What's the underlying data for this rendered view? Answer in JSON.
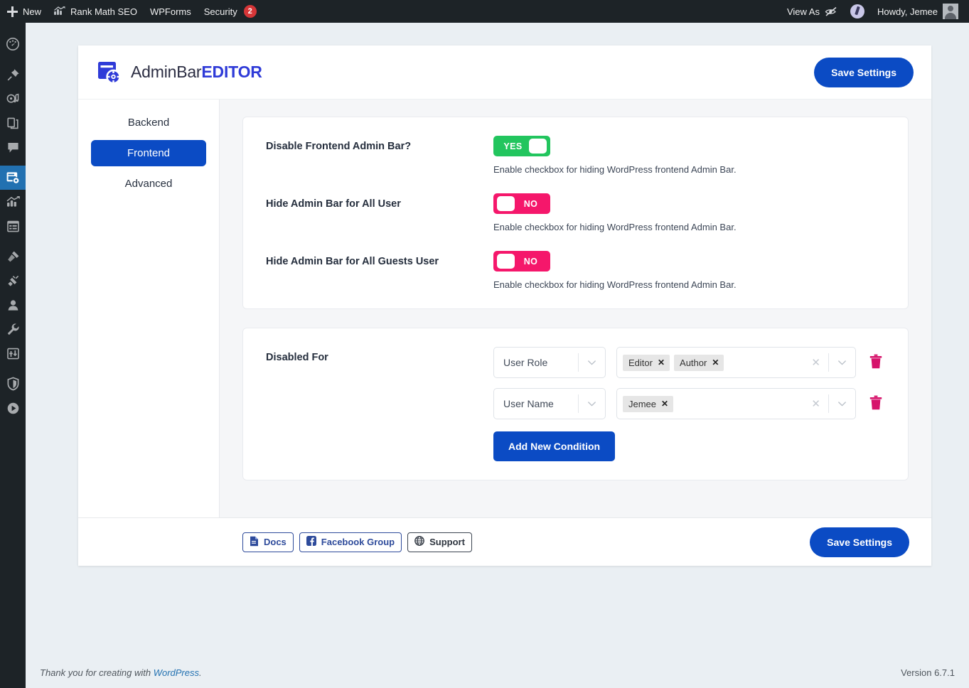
{
  "adminbar": {
    "left_items": [
      {
        "id": "new",
        "label": "New",
        "icon": "plus-icon"
      },
      {
        "id": "rankmath",
        "label": "Rank Math SEO",
        "icon": "rank-math-icon"
      },
      {
        "id": "wpforms",
        "label": "WPForms",
        "icon": ""
      },
      {
        "id": "security",
        "label": "Security",
        "icon": "",
        "badge": "2"
      }
    ],
    "right_items": {
      "view_as_label": "View As",
      "view_as_icon": "eye-slash-icon",
      "howdy_label": "Howdy, Jemee",
      "avatar_icon": "user-avatar"
    }
  },
  "sidebar": {
    "items": [
      {
        "id": "dashboard",
        "icon": "dashboard-icon",
        "active": false
      },
      {
        "id": "posts",
        "icon": "pin-icon",
        "active": false
      },
      {
        "id": "media",
        "icon": "media-icon",
        "active": false
      },
      {
        "id": "pages",
        "icon": "pages-icon",
        "active": false
      },
      {
        "id": "comments",
        "icon": "comment-icon",
        "active": false
      },
      {
        "id": "adminbar-editor",
        "icon": "adminbar-editor-icon",
        "active": true
      },
      {
        "id": "analytics",
        "icon": "chart-icon",
        "active": false
      },
      {
        "id": "forms",
        "icon": "forms-icon",
        "active": false
      },
      {
        "id": "appearance",
        "icon": "brush-icon",
        "active": false
      },
      {
        "id": "plugins",
        "icon": "plug-icon",
        "active": false
      },
      {
        "id": "users",
        "icon": "user-icon",
        "active": false
      },
      {
        "id": "tools",
        "icon": "wrench-icon",
        "active": false
      },
      {
        "id": "settings",
        "icon": "sliders-icon",
        "active": false
      },
      {
        "id": "security",
        "icon": "shield-icon",
        "active": false
      },
      {
        "id": "player",
        "icon": "play-circle-icon",
        "active": false
      }
    ]
  },
  "header": {
    "brand_first": "AdminBar",
    "brand_second": "EDITOR",
    "logo_icon": "adminbar-editor-logo",
    "save_label": "Save Settings"
  },
  "nav": {
    "tabs": [
      {
        "id": "backend",
        "label": "Backend",
        "active": false
      },
      {
        "id": "frontend",
        "label": "Frontend",
        "active": true
      },
      {
        "id": "advanced",
        "label": "Advanced",
        "active": false
      }
    ]
  },
  "settings_panel": {
    "rows": [
      {
        "label": "Disable Frontend Admin Bar?",
        "toggle_state": "YES",
        "toggle_on": true,
        "help": "Enable checkbox for hiding WordPress frontend Admin Bar."
      },
      {
        "label": "Hide Admin Bar for All User",
        "toggle_state": "NO",
        "toggle_on": false,
        "help": "Enable checkbox for hiding WordPress frontend Admin Bar."
      },
      {
        "label": "Hide Admin Bar for All Guests User",
        "toggle_state": "NO",
        "toggle_on": false,
        "help": "Enable checkbox for hiding WordPress frontend Admin Bar."
      }
    ]
  },
  "conditions_panel": {
    "label": "Disabled For",
    "rows": [
      {
        "type_value": "User Role",
        "chips": [
          "Editor",
          "Author"
        ],
        "chip_remove_label": "✕",
        "clear_label": "✕",
        "delete_icon": "trash-icon"
      },
      {
        "type_value": "User Name",
        "chips": [
          "Jemee"
        ],
        "chip_remove_label": "✕",
        "clear_label": "✕",
        "delete_icon": "trash-icon"
      }
    ],
    "add_label": "Add New Condition"
  },
  "footer": {
    "links": [
      {
        "id": "docs",
        "label": "Docs",
        "icon": "doc-icon",
        "style": "blue"
      },
      {
        "id": "facebook-group",
        "label": "Facebook Group",
        "icon": "facebook-icon",
        "style": "blue"
      },
      {
        "id": "support",
        "label": "Support",
        "icon": "globe-icon",
        "style": "dark"
      }
    ],
    "save_label": "Save Settings"
  },
  "wpfooter": {
    "thanks_prefix": "Thank you for creating with ",
    "wordpress_label": "WordPress",
    "thanks_suffix": ".",
    "version": "Version 6.7.1"
  },
  "colors": {
    "brand_blue": "#0b4bc4",
    "toggle_on": "#22c55e",
    "toggle_off": "#f5176b",
    "wp_dark": "#1d2327",
    "wp_active": "#2271b1",
    "badge_red": "#d63638",
    "trash_pink": "#d6136b"
  }
}
